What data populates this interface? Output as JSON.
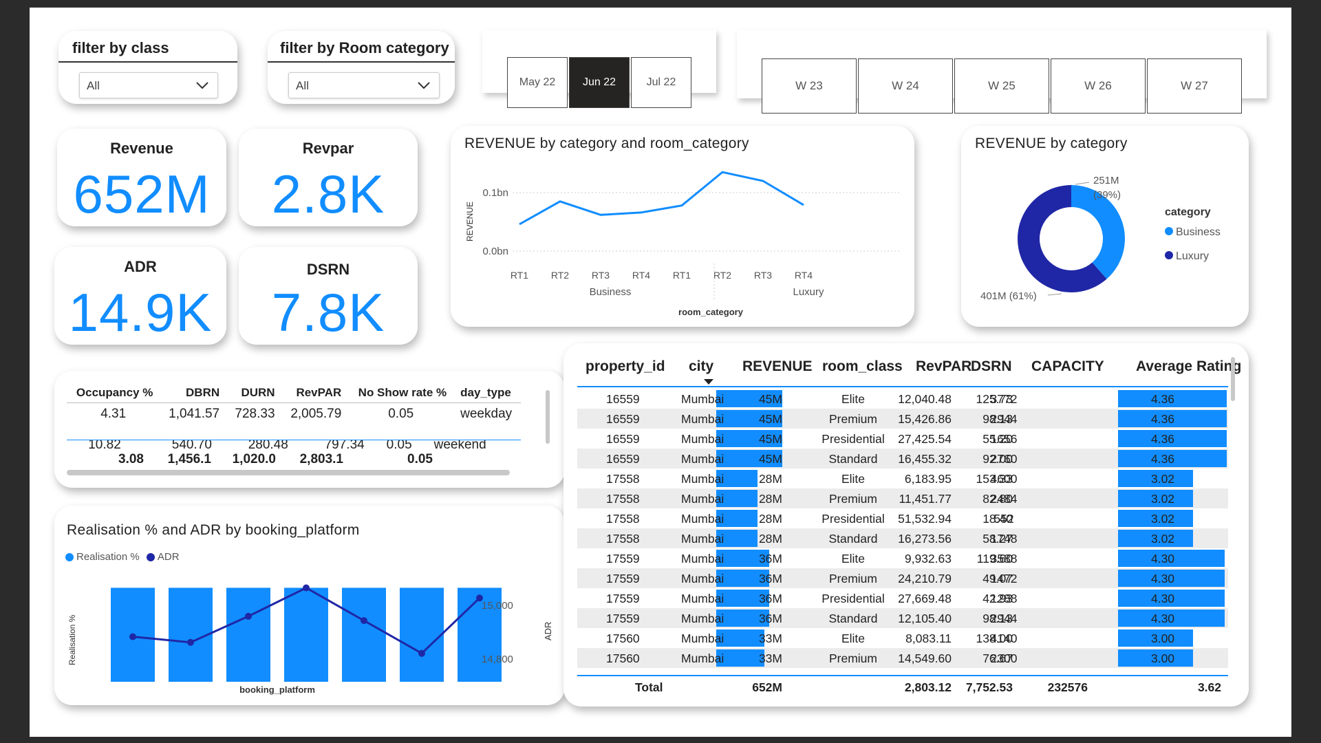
{
  "slicers": {
    "class": {
      "title": "filter by class",
      "value": "All"
    },
    "room_category": {
      "title": "filter by Room category",
      "value": "All"
    }
  },
  "months": [
    {
      "label": "May 22",
      "selected": false
    },
    {
      "label": "Jun 22",
      "selected": true
    },
    {
      "label": "Jul 22",
      "selected": false
    }
  ],
  "weeks": [
    "W 23",
    "W 24",
    "W 25",
    "W 26",
    "W 27"
  ],
  "kpis": {
    "revenue": {
      "label": "Revenue",
      "value": "652M"
    },
    "revpar": {
      "label": "Revpar",
      "value": "2.8K"
    },
    "adr": {
      "label": "ADR",
      "value": "14.9K"
    },
    "dsrn": {
      "label": "DSRN",
      "value": "7.8K"
    }
  },
  "occupancy_table": {
    "headers": [
      "Occupancy %",
      "DBRN",
      "DURN",
      "RevPAR",
      "No Show rate %",
      "day_type"
    ],
    "rows": [
      [
        "4.31",
        "1,041.57",
        "728.33",
        "2,005.79",
        "0.05",
        "weekday"
      ],
      [
        "10.82",
        "540.70",
        "280.48",
        "797.34",
        "0.05",
        "weekend"
      ]
    ],
    "total": [
      "3.08",
      "1,456.1",
      "1,020.0",
      "2,803.1",
      "0.05",
      ""
    ]
  },
  "line_chart": {
    "title": "REVENUE by category and room_category",
    "ylabel": "REVENUE",
    "xlabel": "room_category",
    "ticks_y": [
      "0.1bn",
      "0.0bn"
    ],
    "groups": [
      "Business",
      "Luxury"
    ],
    "x": [
      "RT1",
      "RT2",
      "RT3",
      "RT4",
      "RT1",
      "RT2",
      "RT3",
      "RT4"
    ],
    "chart_data": {
      "type": "line",
      "categories": [
        "Business RT1",
        "Business RT2",
        "Business RT3",
        "Business RT4",
        "Luxury RT1",
        "Luxury RT2",
        "Luxury RT3",
        "Luxury RT4"
      ],
      "values": [
        0.046,
        0.085,
        0.062,
        0.066,
        0.078,
        0.135,
        0.12,
        0.079
      ],
      "ylim": [
        0,
        0.15
      ]
    }
  },
  "donut_chart": {
    "title": "REVENUE by category",
    "legend_title": "category",
    "chart_data": {
      "type": "pie",
      "labels": [
        "Business",
        "Luxury"
      ],
      "values": [
        251,
        401
      ],
      "colors": [
        "#118DFF",
        "#1F27A6"
      ]
    },
    "label_business": "251M",
    "label_business_pct": "(39%)",
    "label_luxury": "401M (61%)"
  },
  "combo_chart": {
    "title": "Realisation % and ADR by booking_platform",
    "legend": [
      "Realisation %",
      "ADR"
    ],
    "ylabel_left": "Realisation %",
    "ylabel_right": "ADR",
    "xlabel": "booking_platform",
    "right_ticks": [
      "15,000",
      "14,800"
    ],
    "chart_data": {
      "type": "bar",
      "series": [
        {
          "name": "Realisation %",
          "values": [
            0.99,
            0.99,
            0.99,
            0.99,
            0.99,
            0.99,
            0.99
          ]
        },
        {
          "name": "ADR",
          "values": [
            14888,
            14867,
            14964,
            15070,
            14948,
            14826,
            15032
          ]
        }
      ],
      "y2lim": [
        14720,
        15120
      ]
    }
  },
  "property_table": {
    "headers": [
      "property_id",
      "city",
      "REVENUE",
      "room_class",
      "RevPAR",
      "DSRN",
      "CAPACITY",
      "Average Rating"
    ],
    "rows": [
      [
        "16559",
        "Mumbai",
        "45M",
        "Elite",
        "12,040.48",
        "125.73",
        "3772",
        "4.36"
      ],
      [
        "16559",
        "Mumbai",
        "45M",
        "Premium",
        "15,426.86",
        "98.13",
        "2944",
        "4.36"
      ],
      [
        "16559",
        "Mumbai",
        "45M",
        "Presidential",
        "27,425.54",
        "55.20",
        "1656",
        "4.36"
      ],
      [
        "16559",
        "Mumbai",
        "45M",
        "Standard",
        "16,455.32",
        "92.00",
        "2760",
        "4.36"
      ],
      [
        "17558",
        "Mumbai",
        "28M",
        "Elite",
        "6,183.95",
        "153.33",
        "4600",
        "3.02"
      ],
      [
        "17558",
        "Mumbai",
        "28M",
        "Premium",
        "11,451.77",
        "82.80",
        "2484",
        "3.02"
      ],
      [
        "17558",
        "Mumbai",
        "28M",
        "Presidential",
        "51,532.94",
        "18.40",
        "552",
        "3.02"
      ],
      [
        "17558",
        "Mumbai",
        "28M",
        "Standard",
        "16,273.56",
        "58.27",
        "1748",
        "3.02"
      ],
      [
        "17559",
        "Mumbai",
        "36M",
        "Elite",
        "9,932.63",
        "119.60",
        "3588",
        "4.30"
      ],
      [
        "17559",
        "Mumbai",
        "36M",
        "Premium",
        "24,210.79",
        "49.07",
        "1472",
        "4.30"
      ],
      [
        "17559",
        "Mumbai",
        "36M",
        "Presidential",
        "27,669.48",
        "42.93",
        "1288",
        "4.30"
      ],
      [
        "17559",
        "Mumbai",
        "36M",
        "Standard",
        "12,105.40",
        "98.13",
        "2944",
        "4.30"
      ],
      [
        "17560",
        "Mumbai",
        "33M",
        "Elite",
        "8,083.11",
        "138.00",
        "4140",
        "3.00"
      ],
      [
        "17560",
        "Mumbai",
        "33M",
        "Premium",
        "14,549.60",
        "76.67",
        "2300",
        "3.00"
      ]
    ],
    "revenue_fraction": [
      1,
      1,
      1,
      1,
      0.62,
      0.62,
      0.62,
      0.62,
      0.8,
      0.8,
      0.8,
      0.8,
      0.73,
      0.73
    ],
    "rating_fraction": [
      1,
      1,
      1,
      1,
      0.69,
      0.69,
      0.69,
      0.69,
      0.98,
      0.98,
      0.98,
      0.98,
      0.69,
      0.69
    ],
    "total": {
      "label": "Total",
      "revenue": "652M",
      "revpar": "2,803.12",
      "dsrn": "7,752.53",
      "capacity": "232576",
      "rating": "3.62"
    }
  }
}
